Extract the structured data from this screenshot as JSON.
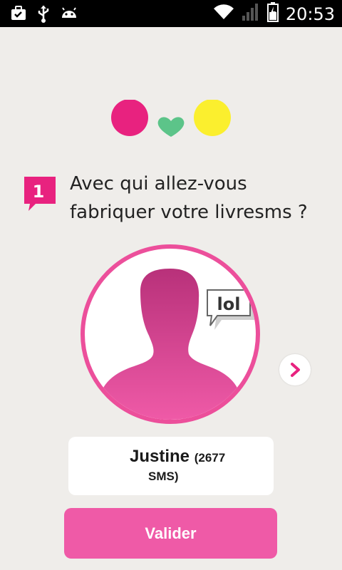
{
  "status_bar": {
    "time": "20:53",
    "icons": [
      "briefcase-check-icon",
      "usb-icon",
      "android-icon",
      "wifi-icon",
      "signal-icon",
      "battery-charging-icon"
    ]
  },
  "step": {
    "number": "1",
    "question_line1": "Avec qui allez-vous",
    "question_line2": "fabriquer votre livresms ?"
  },
  "contact": {
    "name": "Justine",
    "count_part1": "(2677",
    "count_part2": "SMS)",
    "bubble_text": "lol"
  },
  "actions": {
    "validate_label": "Valider"
  },
  "colors": {
    "accent_pink": "#ec4f9b",
    "logo_pink": "#e8227f",
    "logo_green": "#5cc489",
    "logo_yellow": "#fbef2e",
    "background": "#efedea"
  }
}
